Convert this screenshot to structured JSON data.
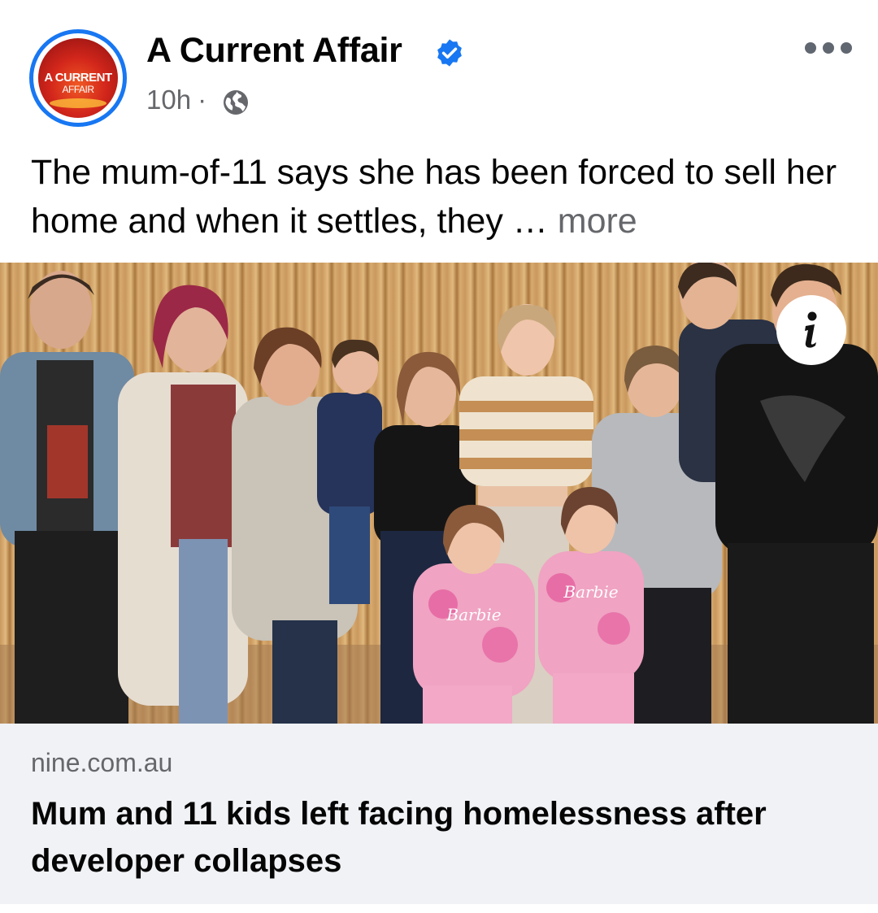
{
  "post": {
    "page_name": "A Current Affair",
    "verified_icon": "verified-badge-icon",
    "time": "10h",
    "separator": "·",
    "audience_icon": "globe-icon",
    "more_icon": "more-horizontal-icon",
    "caption": "The mum-of-11 says she has been forced to sell her home and when it settles, they",
    "ellipsis": "…",
    "see_more": "more",
    "avatar": {
      "line1": "A CURRENT",
      "line2": "AFFAIR"
    },
    "photo": {
      "info_icon": "info-icon",
      "shirt_text": "Barbie"
    }
  },
  "link_preview": {
    "domain": "nine.com.au",
    "title": "Mum and 11 kids left facing homelessness after developer collapses"
  },
  "colors": {
    "accent": "#1877f2",
    "secondary_text": "#65676b",
    "card_background": "#f0f2f5",
    "primary_text": "#050505"
  }
}
